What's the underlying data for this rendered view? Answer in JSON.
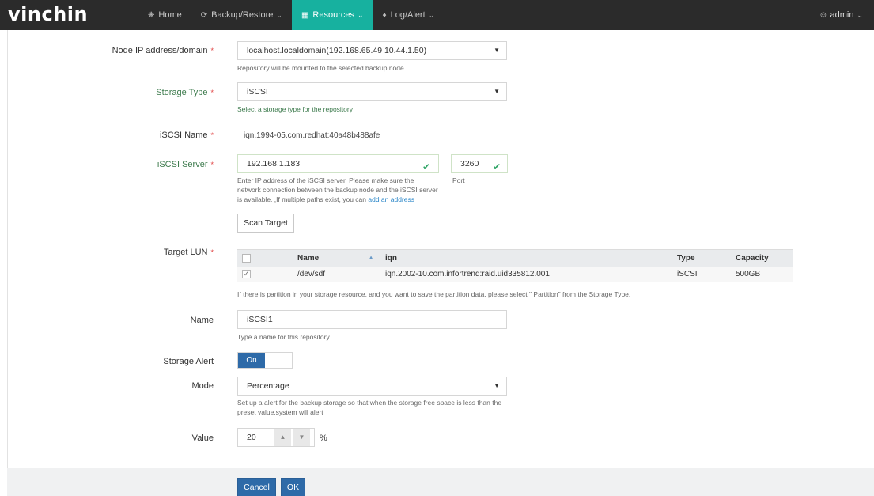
{
  "app": {
    "logo": "vinchin"
  },
  "nav": {
    "home": "Home",
    "backup": "Backup/Restore",
    "resources": "Resources",
    "log": "Log/Alert",
    "user": "admin"
  },
  "form": {
    "node": {
      "label": "Node IP address/domain",
      "value": "localhost.localdomain(192.168.65.49 10.44.1.50)",
      "help": "Repository will be mounted to the selected backup node."
    },
    "storage_type": {
      "label": "Storage Type",
      "value": "iSCSI",
      "help": "Select a storage type for the repository"
    },
    "iscsi_name": {
      "label": "iSCSI Name",
      "value": "iqn.1994-05.com.redhat:40a48b488afe"
    },
    "iscsi_server": {
      "label": "iSCSI Server",
      "value": "192.168.1.183",
      "port_value": "3260",
      "port_label": "Port",
      "help_1": "Enter IP address of the iSCSI server. Please make sure the",
      "help_2": "network connection between the backup node and the iSCSI server",
      "help_3": "is available. ,If multiple paths exist, you can",
      "help_link": "add an address"
    },
    "scan_button": "Scan Target",
    "target_lun": {
      "label": "Target LUN",
      "columns": [
        "Name",
        "iqn",
        "Type",
        "Capacity"
      ],
      "rows": [
        {
          "name": "/dev/sdf",
          "iqn": "iqn.2002-10.com.infortrend:raid.uid335812.001",
          "type": "iSCSI",
          "capacity": "500GB"
        }
      ],
      "help": "If there is partition in your storage resource, and you want to save the partition data, please select \" Partition\" from the Storage Type."
    },
    "name": {
      "label": "Name",
      "value": "iSCSI1",
      "help": "Type a name for this repository."
    },
    "storage_alert": {
      "label": "Storage Alert",
      "toggle": "On"
    },
    "mode": {
      "label": "Mode",
      "value": "Percentage",
      "help_1": "Set up a alert for the backup storage so that when the storage free space is less than the",
      "help_2": "preset value,system will alert"
    },
    "value": {
      "label": "Value",
      "value": "20",
      "unit": "%"
    }
  },
  "footer": {
    "cancel": "Cancel",
    "ok": "OK"
  },
  "colors": {
    "nav_bg": "#2b2b2b",
    "accent": "#17b19f",
    "primary": "#2e6aa8",
    "success": "#2fa566"
  }
}
